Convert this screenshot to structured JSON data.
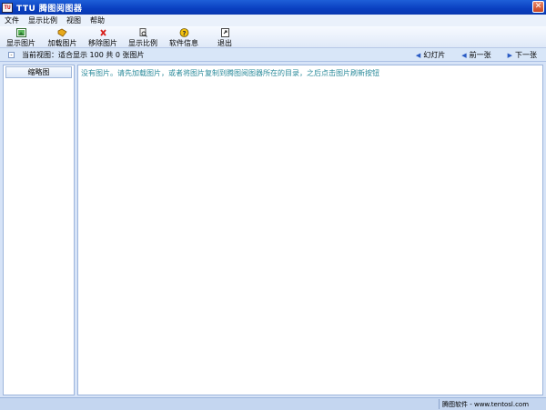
{
  "window": {
    "title": "TTU 腾图阅图器",
    "icon_text": "TU",
    "close_label": "✕"
  },
  "menu": [
    "文件",
    "显示比例",
    "视图",
    "帮助"
  ],
  "toolbar": [
    {
      "label": "显示图片",
      "icon": "show-image-icon"
    },
    {
      "label": "加载图片",
      "icon": "load-image-icon"
    },
    {
      "label": "移除图片",
      "icon": "remove-image-icon"
    },
    {
      "label": "显示比例",
      "icon": "zoom-ratio-icon"
    },
    {
      "label": "软件信息",
      "icon": "help-icon"
    },
    {
      "label": "退出",
      "icon": "exit-icon"
    }
  ],
  "navbar": {
    "toggle": "-",
    "view_info": "当前视图：适合显示 100   共 0 张图片",
    "slideshow": "幻灯片",
    "prev": "前一张",
    "next": "下一张"
  },
  "sidebar": {
    "header": "缩略图"
  },
  "main": {
    "message": "没有图片。请先加载图片，或者将图片复制到腾图阅图器所在的目录，之后点击图片刷新按钮"
  },
  "statusbar": {
    "text": "腾图软件 - www.tentosl.com"
  },
  "colors": {
    "titlebar": "#0a3fc0",
    "message_text": "#2a8a9a",
    "frame": "#d6e3f7"
  }
}
